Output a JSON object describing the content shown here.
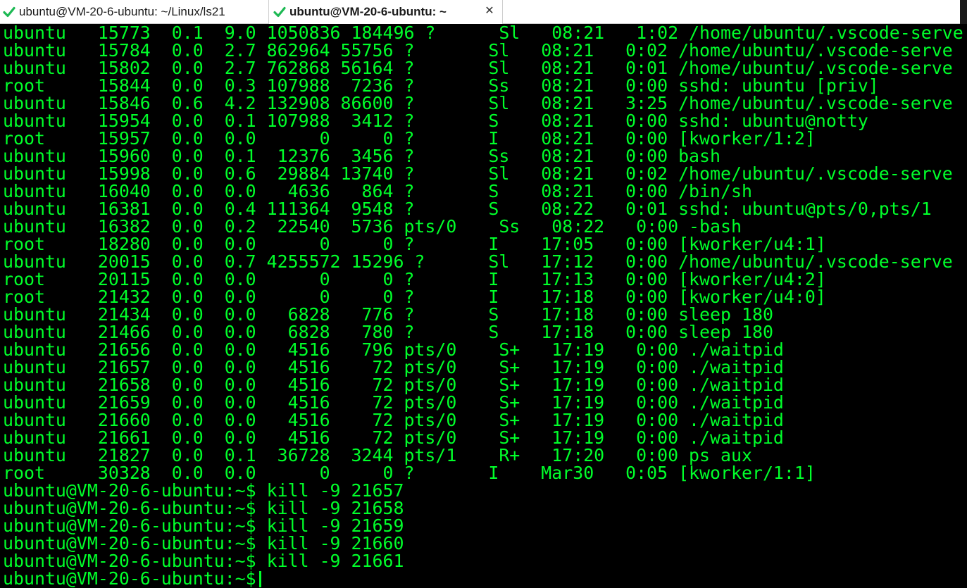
{
  "tabs": [
    {
      "label": "ubuntu@VM-20-6-ubuntu: ~/Linux/ls21",
      "active": false,
      "status_icon": "checkmark-icon"
    },
    {
      "label": "ubuntu@VM-20-6-ubuntu: ~",
      "active": true,
      "status_icon": "checkmark-icon",
      "close_icon": "close-icon"
    }
  ],
  "colors": {
    "terminal_bg": "#000000",
    "terminal_fg": "#00ff2a",
    "check_green": "#1db954"
  },
  "terminal": {
    "lines": [
      "ubuntu   15773  0.1  9.0 1050836 184496 ?      Sl   08:21   1:02 /home/ubuntu/.vscode-serve",
      "ubuntu   15784  0.0  2.7 862964 55756 ?       Sl   08:21   0:02 /home/ubuntu/.vscode-serve",
      "ubuntu   15802  0.0  2.7 762868 56164 ?       Sl   08:21   0:01 /home/ubuntu/.vscode-serve",
      "root     15844  0.0  0.3 107988  7236 ?       Ss   08:21   0:00 sshd: ubuntu [priv]",
      "ubuntu   15846  0.6  4.2 132908 86600 ?       Sl   08:21   3:25 /home/ubuntu/.vscode-serve",
      "ubuntu   15954  0.0  0.1 107988  3412 ?       S    08:21   0:00 sshd: ubuntu@notty",
      "root     15957  0.0  0.0      0     0 ?       I    08:21   0:00 [kworker/1:2]",
      "ubuntu   15960  0.0  0.1  12376  3456 ?       Ss   08:21   0:00 bash",
      "ubuntu   15998  0.0  0.6  29884 13740 ?       Sl   08:21   0:02 /home/ubuntu/.vscode-serve",
      "ubuntu   16040  0.0  0.0   4636   864 ?       S    08:21   0:00 /bin/sh",
      "ubuntu   16381  0.0  0.4 111364  9548 ?       S    08:22   0:01 sshd: ubuntu@pts/0,pts/1",
      "ubuntu   16382  0.0  0.2  22540  5736 pts/0    Ss   08:22   0:00 -bash",
      "root     18280  0.0  0.0      0     0 ?       I    17:05   0:00 [kworker/u4:1]",
      "ubuntu   20015  0.0  0.7 4255572 15296 ?      Sl   17:12   0:00 /home/ubuntu/.vscode-serve",
      "root     20115  0.0  0.0      0     0 ?       I    17:13   0:00 [kworker/u4:2]",
      "root     21432  0.0  0.0      0     0 ?       I    17:18   0:00 [kworker/u4:0]",
      "ubuntu   21434  0.0  0.0   6828   776 ?       S    17:18   0:00 sleep 180",
      "ubuntu   21466  0.0  0.0   6828   780 ?       S    17:18   0:00 sleep 180",
      "ubuntu   21656  0.0  0.0   4516   796 pts/0    S+   17:19   0:00 ./waitpid",
      "ubuntu   21657  0.0  0.0   4516    72 pts/0    S+   17:19   0:00 ./waitpid",
      "ubuntu   21658  0.0  0.0   4516    72 pts/0    S+   17:19   0:00 ./waitpid",
      "ubuntu   21659  0.0  0.0   4516    72 pts/0    S+   17:19   0:00 ./waitpid",
      "ubuntu   21660  0.0  0.0   4516    72 pts/0    S+   17:19   0:00 ./waitpid",
      "ubuntu   21661  0.0  0.0   4516    72 pts/0    S+   17:19   0:00 ./waitpid",
      "ubuntu   21827  0.0  0.1  36728  3244 pts/1    R+   17:20   0:00 ps aux",
      "root     30328  0.0  0.0      0     0 ?       I    Mar30   0:05 [kworker/1:1]",
      "ubuntu@VM-20-6-ubuntu:~$ kill -9 21657",
      "ubuntu@VM-20-6-ubuntu:~$ kill -9 21658",
      "ubuntu@VM-20-6-ubuntu:~$ kill -9 21659",
      "ubuntu@VM-20-6-ubuntu:~$ kill -9 21660",
      "ubuntu@VM-20-6-ubuntu:~$ kill -9 21661"
    ],
    "prompt": "ubuntu@VM-20-6-ubuntu:~$"
  }
}
